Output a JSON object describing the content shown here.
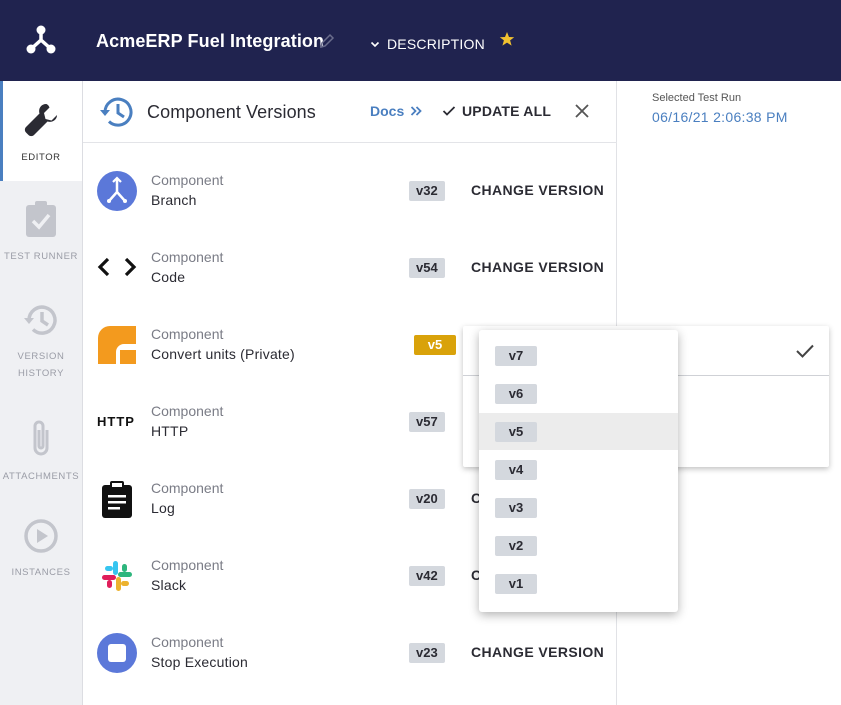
{
  "header": {
    "app_title": "AcmeERP Fuel Integration",
    "description_label": "DESCRIPTION",
    "colors": {
      "background": "#20234f",
      "star": "#f2c230"
    }
  },
  "sidebar": {
    "items": [
      {
        "label": "EDITOR",
        "icon": "wrench-icon",
        "active": true
      },
      {
        "label": "TEST RUNNER",
        "icon": "clipboard-check-icon",
        "active": false
      },
      {
        "label": "VERSION HISTORY",
        "icon": "history-icon",
        "active": false
      },
      {
        "label": "ATTACHMENTS",
        "icon": "paperclip-icon",
        "active": false
      },
      {
        "label": "INSTANCES",
        "icon": "play-circle-icon",
        "active": false
      }
    ]
  },
  "panel": {
    "title": "Component Versions",
    "docs_label": "Docs",
    "update_all_label": "UPDATE ALL",
    "components": [
      {
        "type": "Component",
        "name": "Branch",
        "version": "v32",
        "action": "CHANGE VERSION",
        "icon": "branch-icon"
      },
      {
        "type": "Component",
        "name": "Code",
        "version": "v54",
        "action": "CHANGE VERSION",
        "icon": "code-icon"
      },
      {
        "type": "Component",
        "name": "Convert units (Private)",
        "version": "v5",
        "action": "",
        "icon": "convert-units-icon"
      },
      {
        "type": "Component",
        "name": "HTTP",
        "version": "v57",
        "action": "",
        "icon": "http-icon"
      },
      {
        "type": "Component",
        "name": "Log",
        "version": "v20",
        "action": "C",
        "icon": "log-clipboard-icon"
      },
      {
        "type": "Component",
        "name": "Slack",
        "version": "v42",
        "action": "C",
        "icon": "slack-icon"
      },
      {
        "type": "Component",
        "name": "Stop Execution",
        "version": "v23",
        "action": "CHANGE VERSION",
        "icon": "stop-icon"
      }
    ],
    "http_icon_text": "HTTP"
  },
  "test_run": {
    "label": "Selected Test Run",
    "value": "06/16/21 2:06:38 PM"
  },
  "version_menu": {
    "options": [
      "v7",
      "v6",
      "v5",
      "v4",
      "v3",
      "v2",
      "v1"
    ],
    "selected": "v5"
  }
}
